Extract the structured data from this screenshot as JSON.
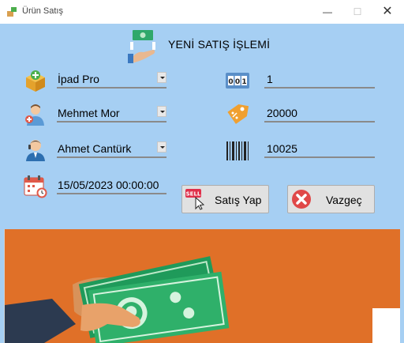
{
  "window": {
    "title": "Ürün Satış",
    "minimize": "—",
    "maximize": "☐",
    "close": "✕"
  },
  "header": {
    "title": "YENİ SATIŞ İŞLEMİ"
  },
  "form": {
    "product": "İpad Pro",
    "customer": "Mehmet Mor",
    "staff": "Ahmet Cantürk",
    "date": "15/05/2023 00:00:00",
    "quantity": "1",
    "price": "20000",
    "barcode": "10025"
  },
  "buttons": {
    "sell": "Satış Yap",
    "cancel": "Vazgeç"
  },
  "icons": {
    "product": "product-box-icon",
    "customer": "customer-icon",
    "staff": "staff-icon",
    "date": "calendar-icon",
    "quantity": "counter-icon",
    "price": "price-tag-icon",
    "barcode": "barcode-icon",
    "sell": "sell-icon",
    "cancel": "cancel-icon"
  },
  "colors": {
    "background": "#a6cff3",
    "banner": "#e07028",
    "money": "#2fa86a"
  }
}
